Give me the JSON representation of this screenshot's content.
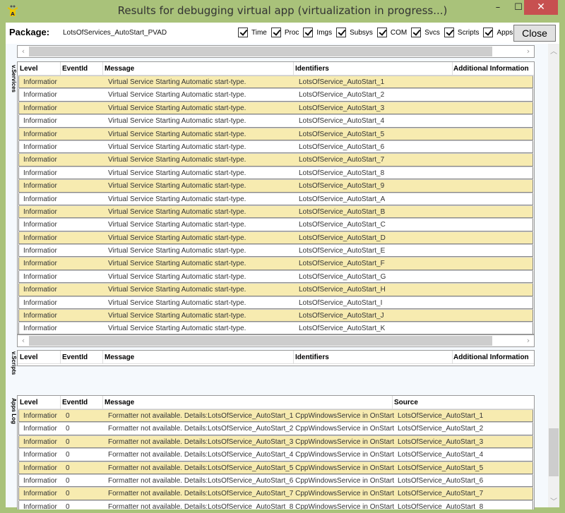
{
  "window": {
    "title": "Results for debugging virtual app (virtualization in progress...)",
    "minimize": "–",
    "maximize": "☐",
    "close": "✕"
  },
  "toolbar": {
    "package_label": "Package:",
    "package_name": "LotsOfServices_AutoStart_PVAD",
    "filters": [
      {
        "label": "Time",
        "checked": true
      },
      {
        "label": "Proc",
        "checked": true
      },
      {
        "label": "Imgs",
        "checked": true
      },
      {
        "label": "Subsys",
        "checked": true
      },
      {
        "label": "COM",
        "checked": true
      },
      {
        "label": "Svcs",
        "checked": true
      },
      {
        "label": "Scripts",
        "checked": true
      },
      {
        "label": "Apps",
        "checked": true
      }
    ],
    "close_label": "Close"
  },
  "sections": {
    "services": "v.Services",
    "scripts": "v.Scripts",
    "apps": "Apps Log"
  },
  "services": {
    "columns": [
      "Level",
      "EventId",
      "Message",
      "Identifiers",
      "Additional Information"
    ],
    "rows": [
      [
        "Informatior",
        "",
        "Virtual Service Starting Automatic start-type.",
        "LotsOfService_AutoStart_1",
        ""
      ],
      [
        "Informatior",
        "",
        "Virtual Service Starting Automatic start-type.",
        "LotsOfService_AutoStart_2",
        ""
      ],
      [
        "Informatior",
        "",
        "Virtual Service Starting Automatic start-type.",
        "LotsOfService_AutoStart_3",
        ""
      ],
      [
        "Informatior",
        "",
        "Virtual Service Starting Automatic start-type.",
        "LotsOfService_AutoStart_4",
        ""
      ],
      [
        "Informatior",
        "",
        "Virtual Service Starting Automatic start-type.",
        "LotsOfService_AutoStart_5",
        ""
      ],
      [
        "Informatior",
        "",
        "Virtual Service Starting Automatic start-type.",
        "LotsOfService_AutoStart_6",
        ""
      ],
      [
        "Informatior",
        "",
        "Virtual Service Starting Automatic start-type.",
        "LotsOfService_AutoStart_7",
        ""
      ],
      [
        "Informatior",
        "",
        "Virtual Service Starting Automatic start-type.",
        "LotsOfService_AutoStart_8",
        ""
      ],
      [
        "Informatior",
        "",
        "Virtual Service Starting Automatic start-type.",
        "LotsOfService_AutoStart_9",
        ""
      ],
      [
        "Informatior",
        "",
        "Virtual Service Starting Automatic start-type.",
        "LotsOfService_AutoStart_A",
        ""
      ],
      [
        "Informatior",
        "",
        "Virtual Service Starting Automatic start-type.",
        "LotsOfService_AutoStart_B",
        ""
      ],
      [
        "Informatior",
        "",
        "Virtual Service Starting Automatic start-type.",
        "LotsOfService_AutoStart_C",
        ""
      ],
      [
        "Informatior",
        "",
        "Virtual Service Starting Automatic start-type.",
        "LotsOfService_AutoStart_D",
        ""
      ],
      [
        "Informatior",
        "",
        "Virtual Service Starting Automatic start-type.",
        "LotsOfService_AutoStart_E",
        ""
      ],
      [
        "Informatior",
        "",
        "Virtual Service Starting Automatic start-type.",
        "LotsOfService_AutoStart_F",
        ""
      ],
      [
        "Informatior",
        "",
        "Virtual Service Starting Automatic start-type.",
        "LotsOfService_AutoStart_G",
        ""
      ],
      [
        "Informatior",
        "",
        "Virtual Service Starting Automatic start-type.",
        "LotsOfService_AutoStart_H",
        ""
      ],
      [
        "Informatior",
        "",
        "Virtual Service Starting Automatic start-type.",
        "LotsOfService_AutoStart_I",
        ""
      ],
      [
        "Informatior",
        "",
        "Virtual Service Starting Automatic start-type.",
        "LotsOfService_AutoStart_J",
        ""
      ],
      [
        "Informatior",
        "",
        "Virtual Service Starting Automatic start-type.",
        "LotsOfService_AutoStart_K",
        ""
      ]
    ]
  },
  "scripts": {
    "columns": [
      "Level",
      "EventId",
      "Message",
      "Identifiers",
      "Additional Information"
    ],
    "rows": []
  },
  "apps": {
    "columns": [
      "Level",
      "EventId",
      "Message",
      "Source"
    ],
    "rows": [
      [
        "Informatior",
        "0",
        "Formatter not available. Details:LotsOfService_AutoStart_1  CppWindowsService in OnStart",
        "LotsOfService_AutoStart_1"
      ],
      [
        "Informatior",
        "0",
        "Formatter not available. Details:LotsOfService_AutoStart_2  CppWindowsService in OnStart",
        "LotsOfService_AutoStart_2"
      ],
      [
        "Informatior",
        "0",
        "Formatter not available. Details:LotsOfService_AutoStart_3  CppWindowsService in OnStart",
        "LotsOfService_AutoStart_3"
      ],
      [
        "Informatior",
        "0",
        "Formatter not available. Details:LotsOfService_AutoStart_4  CppWindowsService in OnStart",
        "LotsOfService_AutoStart_4"
      ],
      [
        "Informatior",
        "0",
        "Formatter not available. Details:LotsOfService_AutoStart_5  CppWindowsService in OnStart",
        "LotsOfService_AutoStart_5"
      ],
      [
        "Informatior",
        "0",
        "Formatter not available. Details:LotsOfService_AutoStart_6  CppWindowsService in OnStart",
        "LotsOfService_AutoStart_6"
      ],
      [
        "Informatior",
        "0",
        "Formatter not available. Details:LotsOfService_AutoStart_7  CppWindowsService in OnStart",
        "LotsOfService_AutoStart_7"
      ],
      [
        "Informatior",
        "0",
        "Formatter not available. Details:LotsOfService_AutoStart_8  CppWindowsService in OnStart",
        "LotsOfService_AutoStart_8"
      ]
    ]
  },
  "colors": {
    "frame": "#a9c27a",
    "row_highlight": "#f7ebb0",
    "close_button": "#c75050"
  },
  "icons": {
    "app": "app-logo-icon",
    "scroll_left": "‹",
    "scroll_right": "›",
    "scroll_up": "︿",
    "scroll_down": "﹀"
  }
}
